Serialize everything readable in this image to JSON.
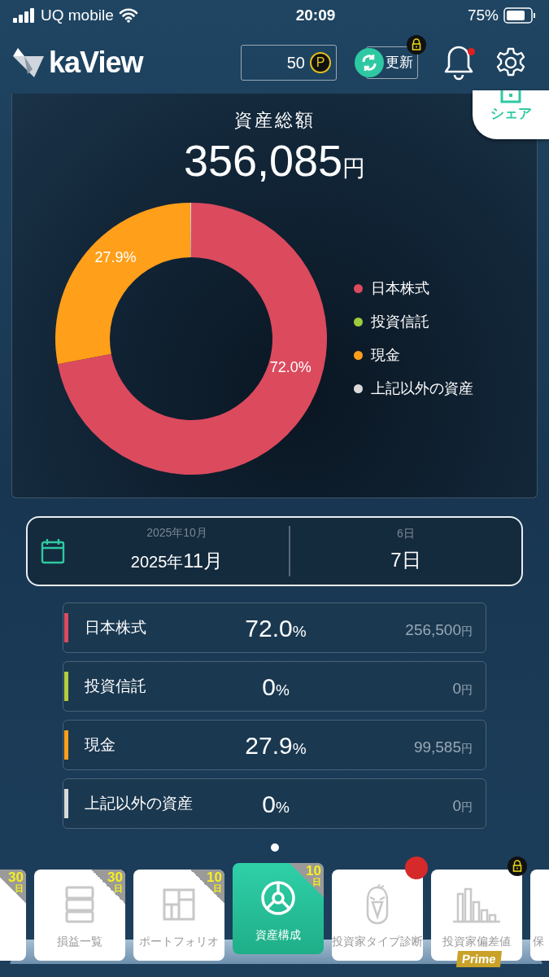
{
  "status_bar": {
    "carrier": "UQ mobile",
    "time": "20:09",
    "battery": "75%"
  },
  "header": {
    "logo": "kaView",
    "points": "50",
    "point_unit": "P",
    "refresh": "更新",
    "refresh_locked": true,
    "notification_unread": true
  },
  "summary": {
    "title": "資産総額",
    "amount": "356,085",
    "unit": "円",
    "share": "シェア",
    "chart_data": {
      "type": "donut",
      "categories": [
        "日本株式",
        "投資信託",
        "現金",
        "上記以外の資産"
      ],
      "series": [
        {
          "values": [
            72.0,
            0,
            27.9,
            0.1
          ]
        }
      ],
      "value_labels": [
        "72.0%",
        null,
        "27.9%",
        null
      ]
    },
    "legend": [
      {
        "color": "#dc4a5e"
      },
      {
        "color": "#9ccc3c"
      },
      {
        "color": "#ff9f1a"
      },
      {
        "color": "#d9d9d9"
      }
    ]
  },
  "date_picker": {
    "prev_month": "2025年10月",
    "year": "2025年",
    "month": "11月",
    "prev_day": "6日",
    "day": "7日"
  },
  "rows": [
    {
      "name": "日本株式",
      "percent": "72.0",
      "percent_unit": "%",
      "amount": "256,500",
      "amount_unit": "円",
      "color": "#dc4a5e"
    },
    {
      "name": "投資信託",
      "percent": "0",
      "percent_unit": "%",
      "amount": "0",
      "amount_unit": "円",
      "color": "#b5cc3c"
    },
    {
      "name": "現金",
      "percent": "27.9",
      "percent_unit": "%",
      "amount": "99,585",
      "amount_unit": "円",
      "color": "#ff9f1a"
    },
    {
      "name": "上記以外の資産",
      "percent": "0",
      "percent_unit": "%",
      "amount": "0",
      "amount_unit": "円",
      "color": "#d9d9d9"
    }
  ],
  "tabs": [
    {
      "kind": "none",
      "badge": "30",
      "badge_unit": "日",
      "selected": false,
      "locked": false,
      "alert": false
    },
    {
      "kind": "list",
      "label": "損益一覧",
      "badge": "30",
      "badge_unit": "日",
      "selected": false,
      "locked": false,
      "alert": false
    },
    {
      "kind": "portfolio",
      "label": "ポートフォリオ",
      "badge": "10",
      "badge_unit": "日",
      "selected": false,
      "locked": false,
      "alert": false
    },
    {
      "kind": "donut",
      "label": "資産構成",
      "badge": "10",
      "badge_unit": "日",
      "selected": true,
      "locked": false,
      "alert": false
    },
    {
      "kind": "face",
      "label": "投資家タイプ診断",
      "selected": false,
      "locked": false,
      "alert": true
    },
    {
      "kind": "bars",
      "label": "投資家偏差値",
      "tag": "Prime",
      "selected": false,
      "locked": true,
      "alert": false
    },
    {
      "kind": "none",
      "label": "保",
      "selected": false,
      "locked": false,
      "alert": false
    }
  ]
}
